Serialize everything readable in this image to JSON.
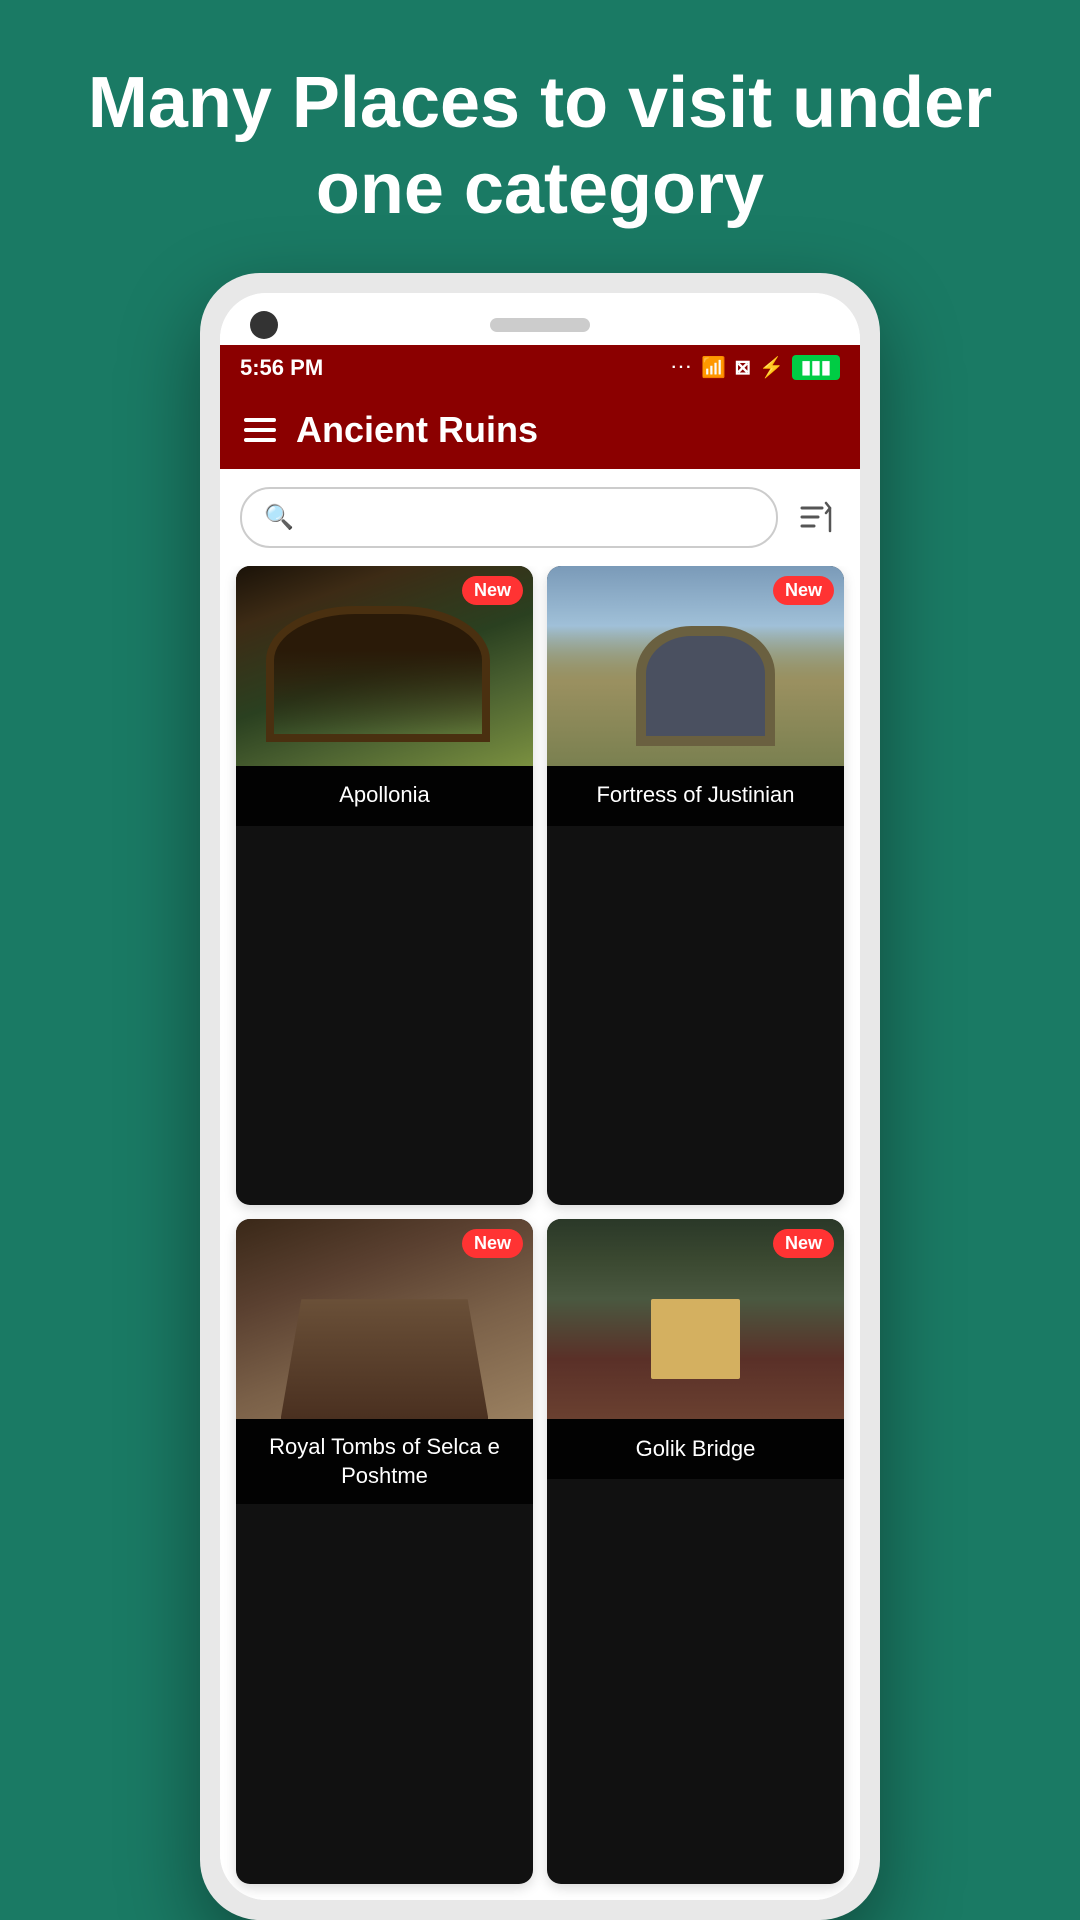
{
  "background_color": "#1a7a64",
  "hero": {
    "text": "Many Places to visit under one category"
  },
  "status_bar": {
    "time": "5:56 PM",
    "battery_color": "#00cc44"
  },
  "app_bar": {
    "title": "Ancient Ruins"
  },
  "search": {
    "placeholder": ""
  },
  "cards": [
    {
      "id": "apollonia",
      "title": "Apollonia",
      "badge": "New",
      "image_type": "apollonia"
    },
    {
      "id": "fortress",
      "title": "Fortress of Justinian",
      "badge": "New",
      "image_type": "fortress"
    },
    {
      "id": "tombs",
      "title": "Royal Tombs of Selca e Poshtme",
      "badge": "New",
      "image_type": "tombs"
    },
    {
      "id": "golik",
      "title": "Golik Bridge",
      "badge": "New",
      "image_type": "golik"
    }
  ]
}
